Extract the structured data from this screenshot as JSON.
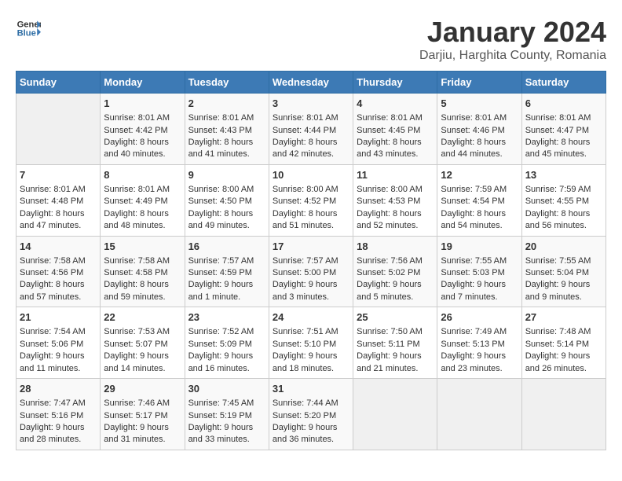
{
  "logo": {
    "general": "General",
    "blue": "Blue"
  },
  "title": "January 2024",
  "subtitle": "Darjiu, Harghita County, Romania",
  "days_header": [
    "Sunday",
    "Monday",
    "Tuesday",
    "Wednesday",
    "Thursday",
    "Friday",
    "Saturday"
  ],
  "weeks": [
    [
      {
        "day": "",
        "content": ""
      },
      {
        "day": "1",
        "sunrise": "Sunrise: 8:01 AM",
        "sunset": "Sunset: 4:42 PM",
        "daylight": "Daylight: 8 hours and 40 minutes."
      },
      {
        "day": "2",
        "sunrise": "Sunrise: 8:01 AM",
        "sunset": "Sunset: 4:43 PM",
        "daylight": "Daylight: 8 hours and 41 minutes."
      },
      {
        "day": "3",
        "sunrise": "Sunrise: 8:01 AM",
        "sunset": "Sunset: 4:44 PM",
        "daylight": "Daylight: 8 hours and 42 minutes."
      },
      {
        "day": "4",
        "sunrise": "Sunrise: 8:01 AM",
        "sunset": "Sunset: 4:45 PM",
        "daylight": "Daylight: 8 hours and 43 minutes."
      },
      {
        "day": "5",
        "sunrise": "Sunrise: 8:01 AM",
        "sunset": "Sunset: 4:46 PM",
        "daylight": "Daylight: 8 hours and 44 minutes."
      },
      {
        "day": "6",
        "sunrise": "Sunrise: 8:01 AM",
        "sunset": "Sunset: 4:47 PM",
        "daylight": "Daylight: 8 hours and 45 minutes."
      }
    ],
    [
      {
        "day": "7",
        "sunrise": "Sunrise: 8:01 AM",
        "sunset": "Sunset: 4:48 PM",
        "daylight": "Daylight: 8 hours and 47 minutes."
      },
      {
        "day": "8",
        "sunrise": "Sunrise: 8:01 AM",
        "sunset": "Sunset: 4:49 PM",
        "daylight": "Daylight: 8 hours and 48 minutes."
      },
      {
        "day": "9",
        "sunrise": "Sunrise: 8:00 AM",
        "sunset": "Sunset: 4:50 PM",
        "daylight": "Daylight: 8 hours and 49 minutes."
      },
      {
        "day": "10",
        "sunrise": "Sunrise: 8:00 AM",
        "sunset": "Sunset: 4:52 PM",
        "daylight": "Daylight: 8 hours and 51 minutes."
      },
      {
        "day": "11",
        "sunrise": "Sunrise: 8:00 AM",
        "sunset": "Sunset: 4:53 PM",
        "daylight": "Daylight: 8 hours and 52 minutes."
      },
      {
        "day": "12",
        "sunrise": "Sunrise: 7:59 AM",
        "sunset": "Sunset: 4:54 PM",
        "daylight": "Daylight: 8 hours and 54 minutes."
      },
      {
        "day": "13",
        "sunrise": "Sunrise: 7:59 AM",
        "sunset": "Sunset: 4:55 PM",
        "daylight": "Daylight: 8 hours and 56 minutes."
      }
    ],
    [
      {
        "day": "14",
        "sunrise": "Sunrise: 7:58 AM",
        "sunset": "Sunset: 4:56 PM",
        "daylight": "Daylight: 8 hours and 57 minutes."
      },
      {
        "day": "15",
        "sunrise": "Sunrise: 7:58 AM",
        "sunset": "Sunset: 4:58 PM",
        "daylight": "Daylight: 8 hours and 59 minutes."
      },
      {
        "day": "16",
        "sunrise": "Sunrise: 7:57 AM",
        "sunset": "Sunset: 4:59 PM",
        "daylight": "Daylight: 9 hours and 1 minute."
      },
      {
        "day": "17",
        "sunrise": "Sunrise: 7:57 AM",
        "sunset": "Sunset: 5:00 PM",
        "daylight": "Daylight: 9 hours and 3 minutes."
      },
      {
        "day": "18",
        "sunrise": "Sunrise: 7:56 AM",
        "sunset": "Sunset: 5:02 PM",
        "daylight": "Daylight: 9 hours and 5 minutes."
      },
      {
        "day": "19",
        "sunrise": "Sunrise: 7:55 AM",
        "sunset": "Sunset: 5:03 PM",
        "daylight": "Daylight: 9 hours and 7 minutes."
      },
      {
        "day": "20",
        "sunrise": "Sunrise: 7:55 AM",
        "sunset": "Sunset: 5:04 PM",
        "daylight": "Daylight: 9 hours and 9 minutes."
      }
    ],
    [
      {
        "day": "21",
        "sunrise": "Sunrise: 7:54 AM",
        "sunset": "Sunset: 5:06 PM",
        "daylight": "Daylight: 9 hours and 11 minutes."
      },
      {
        "day": "22",
        "sunrise": "Sunrise: 7:53 AM",
        "sunset": "Sunset: 5:07 PM",
        "daylight": "Daylight: 9 hours and 14 minutes."
      },
      {
        "day": "23",
        "sunrise": "Sunrise: 7:52 AM",
        "sunset": "Sunset: 5:09 PM",
        "daylight": "Daylight: 9 hours and 16 minutes."
      },
      {
        "day": "24",
        "sunrise": "Sunrise: 7:51 AM",
        "sunset": "Sunset: 5:10 PM",
        "daylight": "Daylight: 9 hours and 18 minutes."
      },
      {
        "day": "25",
        "sunrise": "Sunrise: 7:50 AM",
        "sunset": "Sunset: 5:11 PM",
        "daylight": "Daylight: 9 hours and 21 minutes."
      },
      {
        "day": "26",
        "sunrise": "Sunrise: 7:49 AM",
        "sunset": "Sunset: 5:13 PM",
        "daylight": "Daylight: 9 hours and 23 minutes."
      },
      {
        "day": "27",
        "sunrise": "Sunrise: 7:48 AM",
        "sunset": "Sunset: 5:14 PM",
        "daylight": "Daylight: 9 hours and 26 minutes."
      }
    ],
    [
      {
        "day": "28",
        "sunrise": "Sunrise: 7:47 AM",
        "sunset": "Sunset: 5:16 PM",
        "daylight": "Daylight: 9 hours and 28 minutes."
      },
      {
        "day": "29",
        "sunrise": "Sunrise: 7:46 AM",
        "sunset": "Sunset: 5:17 PM",
        "daylight": "Daylight: 9 hours and 31 minutes."
      },
      {
        "day": "30",
        "sunrise": "Sunrise: 7:45 AM",
        "sunset": "Sunset: 5:19 PM",
        "daylight": "Daylight: 9 hours and 33 minutes."
      },
      {
        "day": "31",
        "sunrise": "Sunrise: 7:44 AM",
        "sunset": "Sunset: 5:20 PM",
        "daylight": "Daylight: 9 hours and 36 minutes."
      },
      {
        "day": "",
        "content": ""
      },
      {
        "day": "",
        "content": ""
      },
      {
        "day": "",
        "content": ""
      }
    ]
  ]
}
